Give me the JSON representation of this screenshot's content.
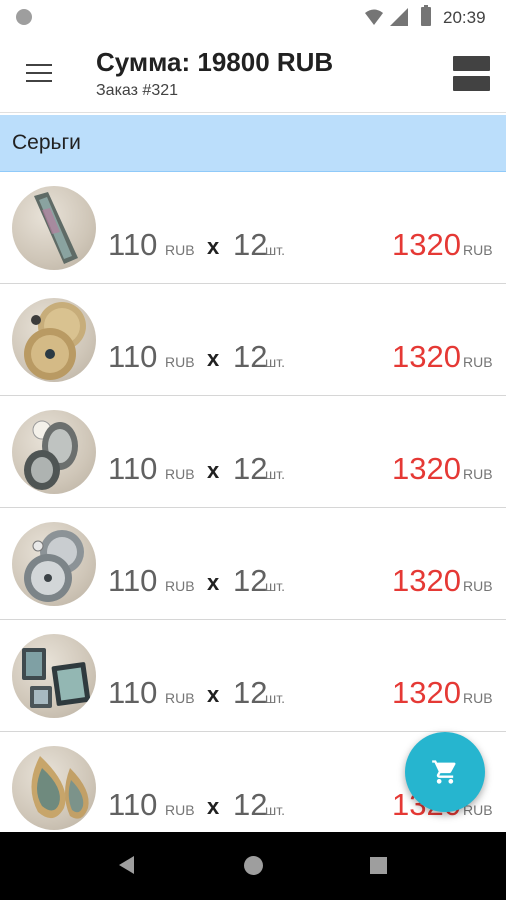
{
  "status_bar": {
    "time": "20:39"
  },
  "app_bar": {
    "title": "Сумма: 19800 RUB",
    "subtitle": "Заказ #321"
  },
  "category": {
    "label": "Серьги"
  },
  "items": [
    {
      "price": "110",
      "currency": "RUB",
      "times": "x",
      "qty": "12",
      "unit": "шт.",
      "total": "1320",
      "total_currency": "RUB"
    },
    {
      "price": "110",
      "currency": "RUB",
      "times": "x",
      "qty": "12",
      "unit": "шт.",
      "total": "1320",
      "total_currency": "RUB"
    },
    {
      "price": "110",
      "currency": "RUB",
      "times": "x",
      "qty": "12",
      "unit": "шт.",
      "total": "1320",
      "total_currency": "RUB"
    },
    {
      "price": "110",
      "currency": "RUB",
      "times": "x",
      "qty": "12",
      "unit": "шт.",
      "total": "1320",
      "total_currency": "RUB"
    },
    {
      "price": "110",
      "currency": "RUB",
      "times": "x",
      "qty": "12",
      "unit": "шт.",
      "total": "1320",
      "total_currency": "RUB"
    },
    {
      "price": "110",
      "currency": "RUB",
      "times": "x",
      "qty": "12",
      "unit": "шт.",
      "total": "1320",
      "total_currency": "RUB"
    }
  ],
  "colors": {
    "category_bg": "#bbdefb",
    "total_text": "#e53935",
    "fab": "#26b5cf"
  },
  "icons": {
    "menu": "hamburger-menu-icon",
    "layout": "view-agenda-icon",
    "fab": "shopping-cart-icon"
  }
}
